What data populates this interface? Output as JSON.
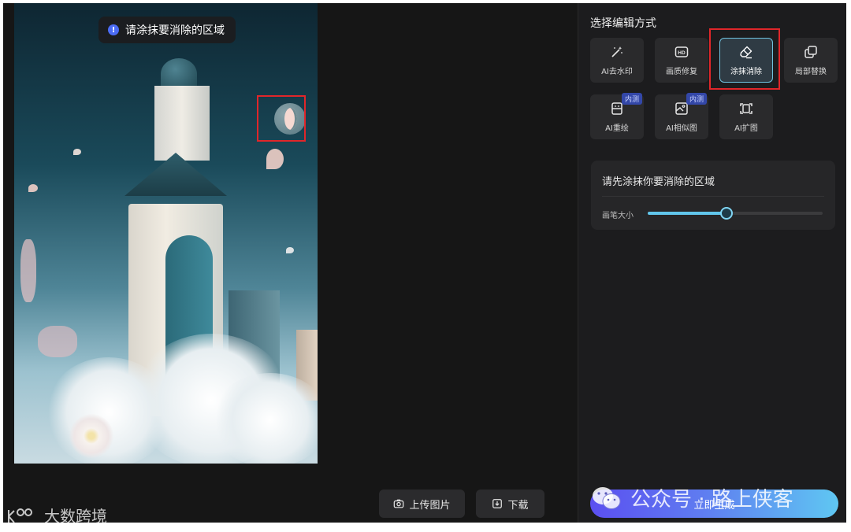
{
  "canvas": {
    "toast_text": "请涂抹要消除的区域",
    "toast_icon": "info-icon"
  },
  "bottom_bar": {
    "upload_label": "上传图片",
    "download_label": "下载"
  },
  "panel": {
    "title": "选择编辑方式",
    "tools": [
      {
        "label": "AI去水印",
        "icon": "magic-wand-icon"
      },
      {
        "label": "画质修复",
        "icon": "hd-icon"
      },
      {
        "label": "涂抹消除",
        "icon": "eraser-icon",
        "active": true
      },
      {
        "label": "局部替换",
        "icon": "replace-icon"
      },
      {
        "label": "AI重绘",
        "icon": "repaint-icon",
        "badge": "内测"
      },
      {
        "label": "AI相似图",
        "icon": "similar-image-icon",
        "badge": "内测"
      },
      {
        "label": "AI扩图",
        "icon": "expand-icon"
      }
    ],
    "erase_section": {
      "title": "请先涂抹你要消除的区域",
      "brush_label": "画笔大小",
      "brush_value_fraction": 0.45
    },
    "generate_label": "立即生成"
  },
  "watermarks": {
    "wechat_text": "公众号 · 路上侠客",
    "brand_text": "大数跨境"
  },
  "colors": {
    "accent": "#61c6ec",
    "highlight": "#e0262a",
    "generate_start": "#5b4ff0",
    "generate_end": "#5fc7f2"
  }
}
